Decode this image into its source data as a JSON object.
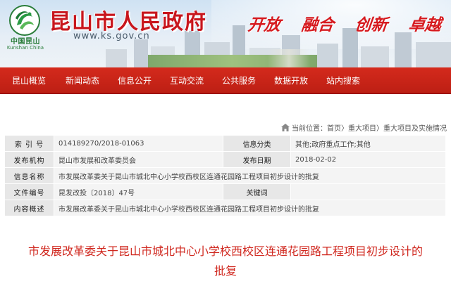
{
  "colors": {
    "brand_red": "#c8161d",
    "nav_red": "#c92317",
    "logo_green": "#2a7d3a",
    "label_bg": "#e7e7e7",
    "value_bg": "#f4f4f4",
    "article_title": "#d0281f"
  },
  "header": {
    "logo_icon": "kunshan-logo-icon",
    "logo_cn": "中国昆山",
    "logo_en": "Kunshan China",
    "site_title": "昆山市人民政府",
    "site_url": "www.ks.gov.cn",
    "slogans": [
      "开放",
      "融合",
      "创新",
      "卓越"
    ]
  },
  "nav": {
    "items": [
      "昆山概览",
      "新闻动态",
      "信息公开",
      "互动交流",
      "公共服务",
      "数据开放",
      "站内搜索"
    ]
  },
  "breadcrumb": {
    "icon": "home-icon",
    "prefix": "当前位置：",
    "items": [
      "首页",
      "重大项目",
      "重大项目及实施情况"
    ],
    "separator": "〉"
  },
  "info": {
    "index_label": "索 引 号",
    "index_value": "014189270/2018-01063",
    "category_label": "信息分类",
    "category_value": "其他;政府重点工作;其他",
    "org_label": "发布机构",
    "org_value": "昆山市发展和改革委员会",
    "date_label": "发布日期",
    "date_value": "2018-02-02",
    "name_label": "信息名称",
    "name_value": "市发展改革委关于昆山市城北中心小学校西校区连通花园路工程项目初步设计的批复",
    "doc_label": "文件编号",
    "doc_value": "昆发改投〔2018〕47号",
    "keyword_label": "关键词",
    "keyword_value": "",
    "summary_label": "内容概述",
    "summary_value": "市发展改革委关于昆山市城北中心小学校西校区连通花园路工程项目初步设计的批复"
  },
  "article": {
    "title_line1": "市发展改革委关于昆山市城北中心小学校西校区连通花园路工程项目初步设计的",
    "title_line2": "批复"
  }
}
